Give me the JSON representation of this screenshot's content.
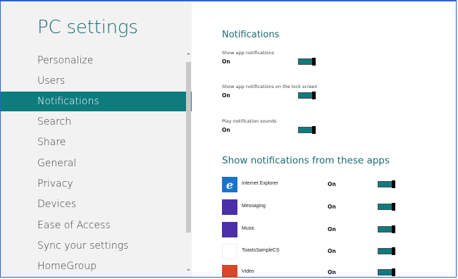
{
  "app_title": "PC settings",
  "sidebar": {
    "items": [
      {
        "label": "Personalize"
      },
      {
        "label": "Users"
      },
      {
        "label": "Notifications",
        "selected": true
      },
      {
        "label": "Search"
      },
      {
        "label": "Share"
      },
      {
        "label": "General"
      },
      {
        "label": "Privacy"
      },
      {
        "label": "Devices"
      },
      {
        "label": "Ease of Access"
      },
      {
        "label": "Sync your settings"
      },
      {
        "label": "HomeGroup"
      }
    ]
  },
  "main": {
    "title": "Notifications",
    "settings": [
      {
        "label": "Show app notifications",
        "value": "On",
        "toggle_on": true
      },
      {
        "label": "Show app notifications on the lock screen",
        "value": "On",
        "toggle_on": true
      },
      {
        "label": "Play notification sounds",
        "value": "On",
        "toggle_on": true
      }
    ],
    "apps_title": "Show notifications from these apps",
    "apps": [
      {
        "name": "Internet Explorer",
        "state": "On",
        "icon": "ie-icon",
        "color": "#1a73c8"
      },
      {
        "name": "Messaging",
        "state": "On",
        "icon": "messaging-icon",
        "color": "#4b2fa6"
      },
      {
        "name": "Music",
        "state": "On",
        "icon": "music-icon",
        "color": "#4b2fa6"
      },
      {
        "name": "ToastsSampleCS",
        "state": "On",
        "icon": "toasts-sample-icon",
        "color": "#ffffff"
      },
      {
        "name": "Video",
        "state": "On",
        "icon": "video-icon",
        "color": "#d7472a"
      }
    ]
  },
  "colors": {
    "accent": "#0e7b7e",
    "title_teal": "#1b6c73",
    "sidebar_bg": "#f2f2f2"
  }
}
